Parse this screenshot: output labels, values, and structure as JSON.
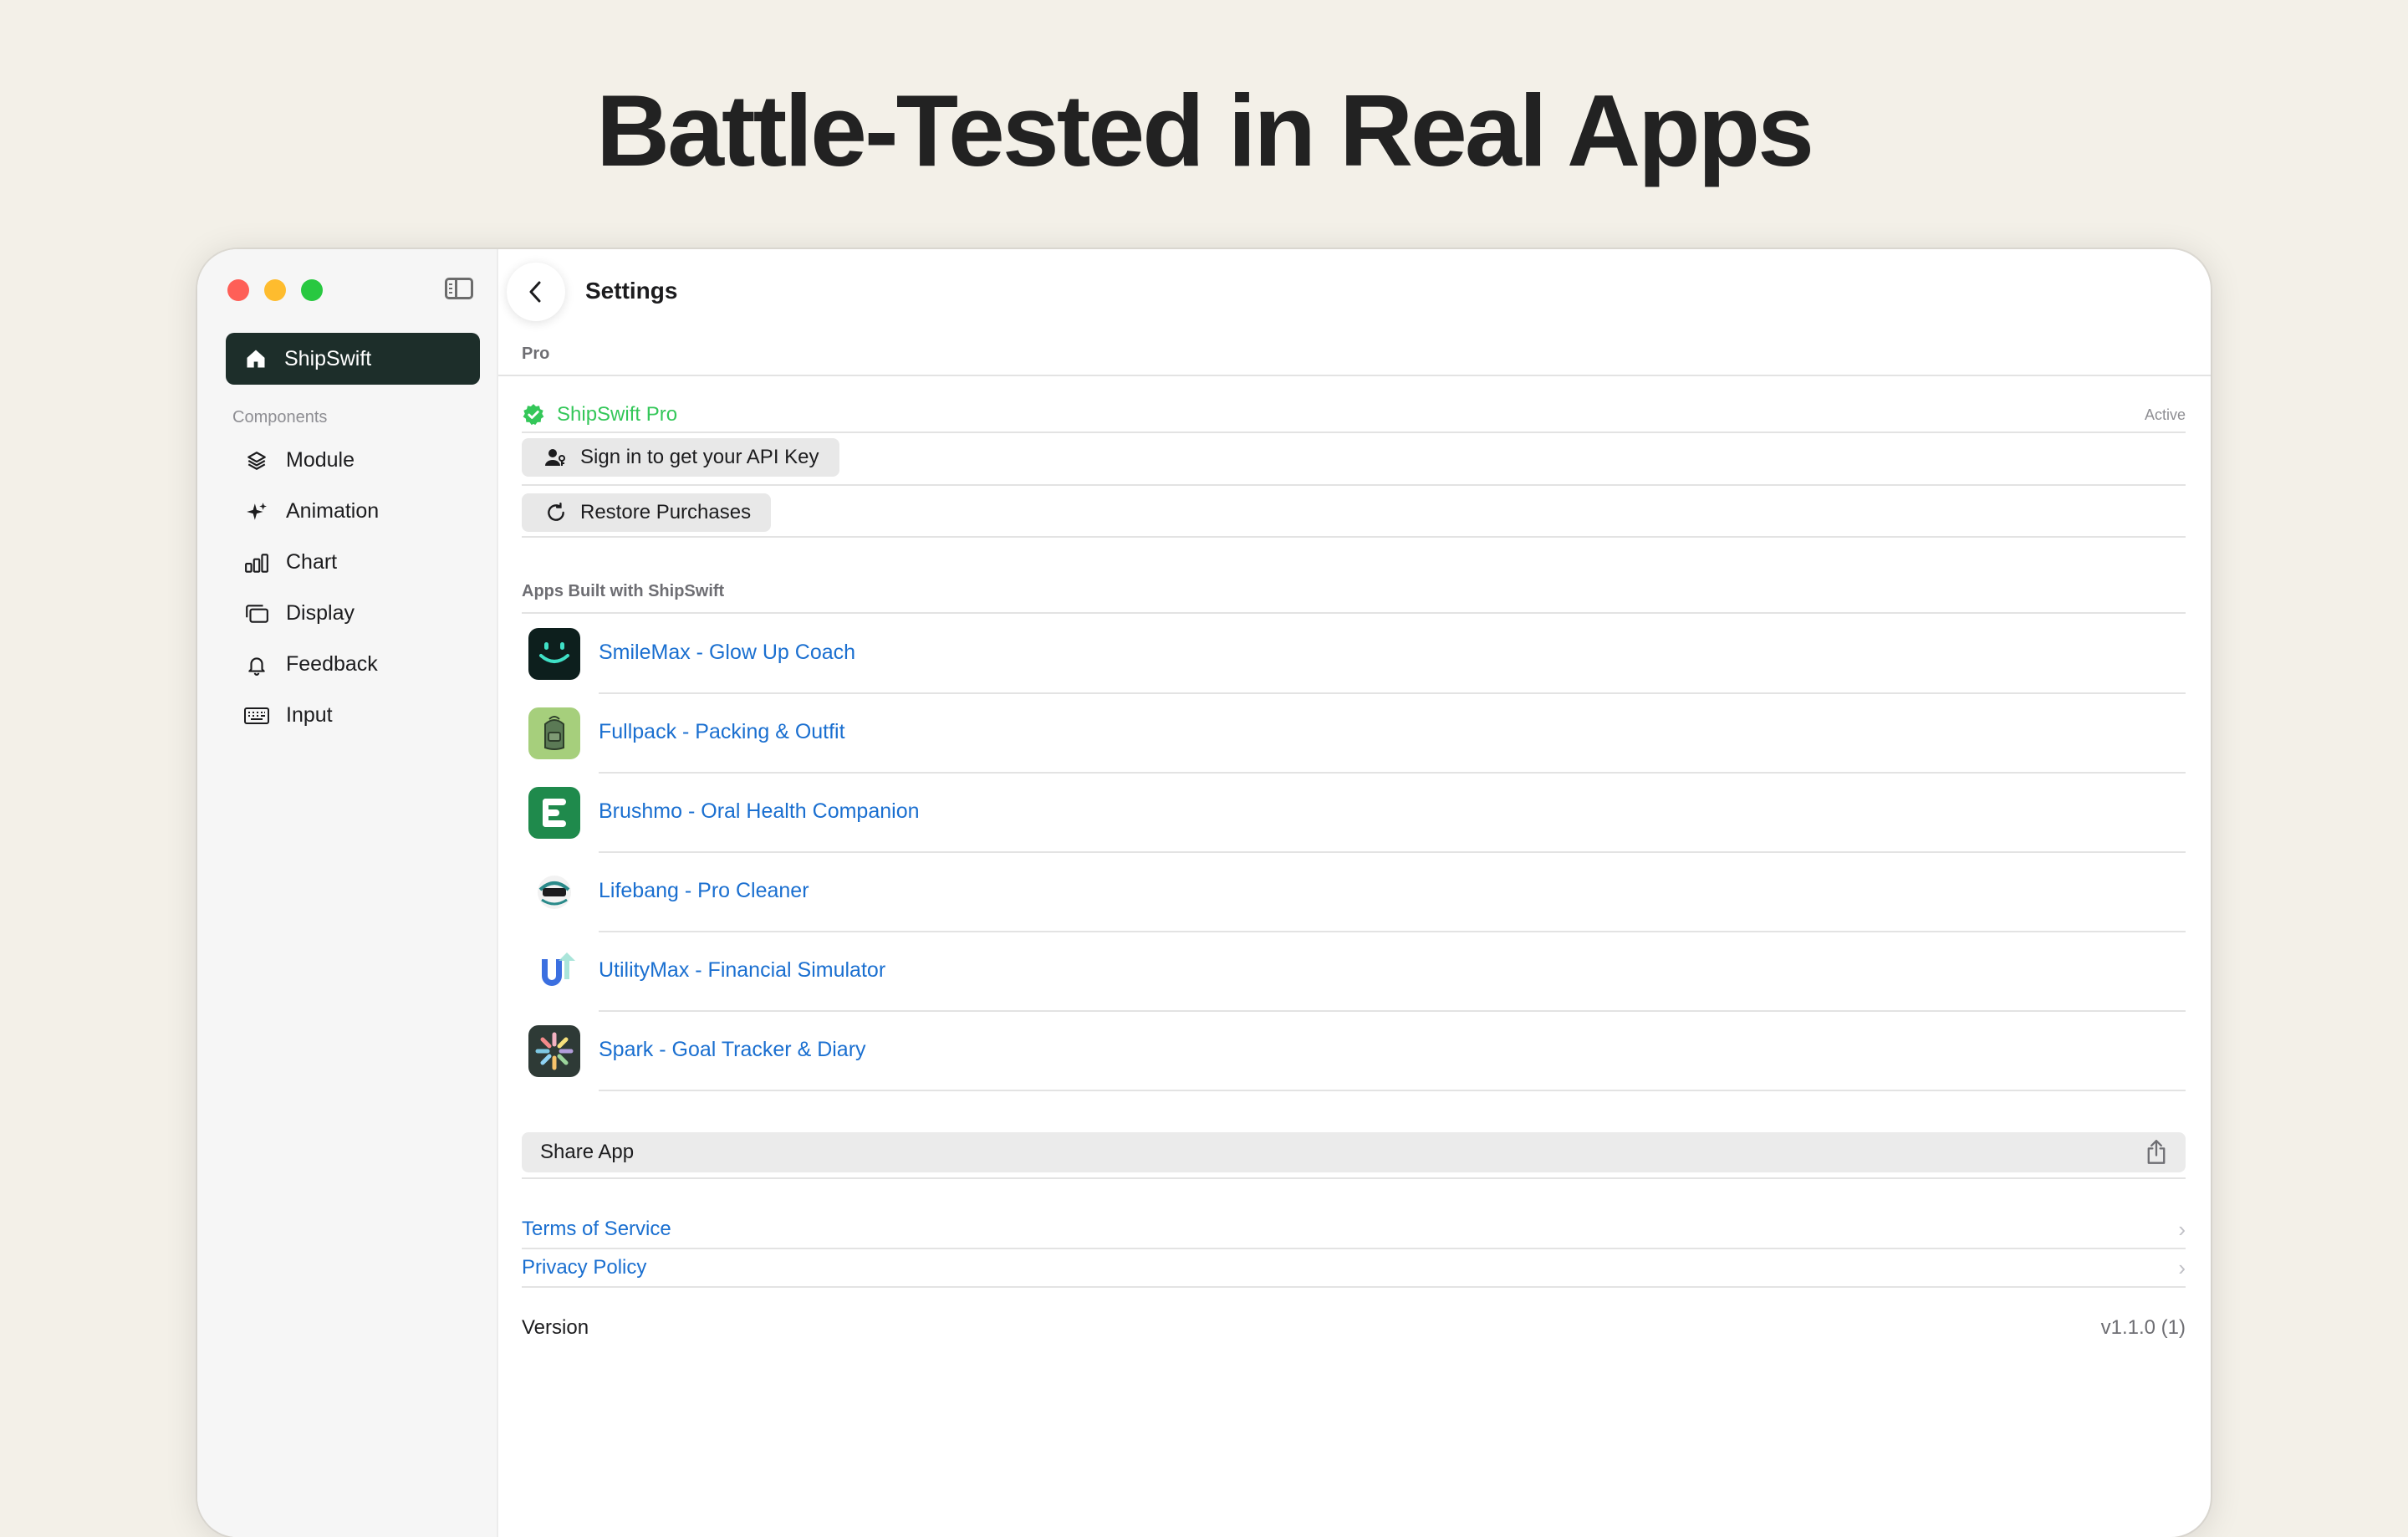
{
  "hero": {
    "title": "Battle-Tested in Real Apps"
  },
  "sidebar": {
    "home_label": "ShipSwift",
    "section_label": "Components",
    "items": [
      {
        "label": "Module",
        "icon": "layers-icon"
      },
      {
        "label": "Animation",
        "icon": "sparkle-icon"
      },
      {
        "label": "Chart",
        "icon": "chart-icon"
      },
      {
        "label": "Display",
        "icon": "display-icon"
      },
      {
        "label": "Feedback",
        "icon": "bell-icon"
      },
      {
        "label": "Input",
        "icon": "keyboard-icon"
      }
    ]
  },
  "header": {
    "title": "Settings"
  },
  "pro": {
    "section_label": "Pro",
    "plan_label": "ShipSwift Pro",
    "status": "Active",
    "sign_in_label": "Sign in to get your API Key",
    "restore_label": "Restore Purchases"
  },
  "apps": {
    "section_label": "Apps Built with ShipSwift",
    "items": [
      {
        "name": "SmileMax - Glow Up Coach"
      },
      {
        "name": "Fullpack - Packing & Outfit"
      },
      {
        "name": "Brushmo - Oral Health Companion"
      },
      {
        "name": "Lifebang - Pro Cleaner"
      },
      {
        "name": "UtilityMax - Financial Simulator"
      },
      {
        "name": "Spark - Goal Tracker & Diary"
      }
    ]
  },
  "share": {
    "label": "Share App"
  },
  "links": {
    "terms": "Terms of Service",
    "privacy": "Privacy Policy"
  },
  "version": {
    "label": "Version",
    "value": "v1.1.0 (1)"
  },
  "colors": {
    "accent": "#1a6fd0",
    "pro_green": "#34c759",
    "sidebar_selected": "#1d2e2a",
    "background": "#f3f0e8"
  }
}
